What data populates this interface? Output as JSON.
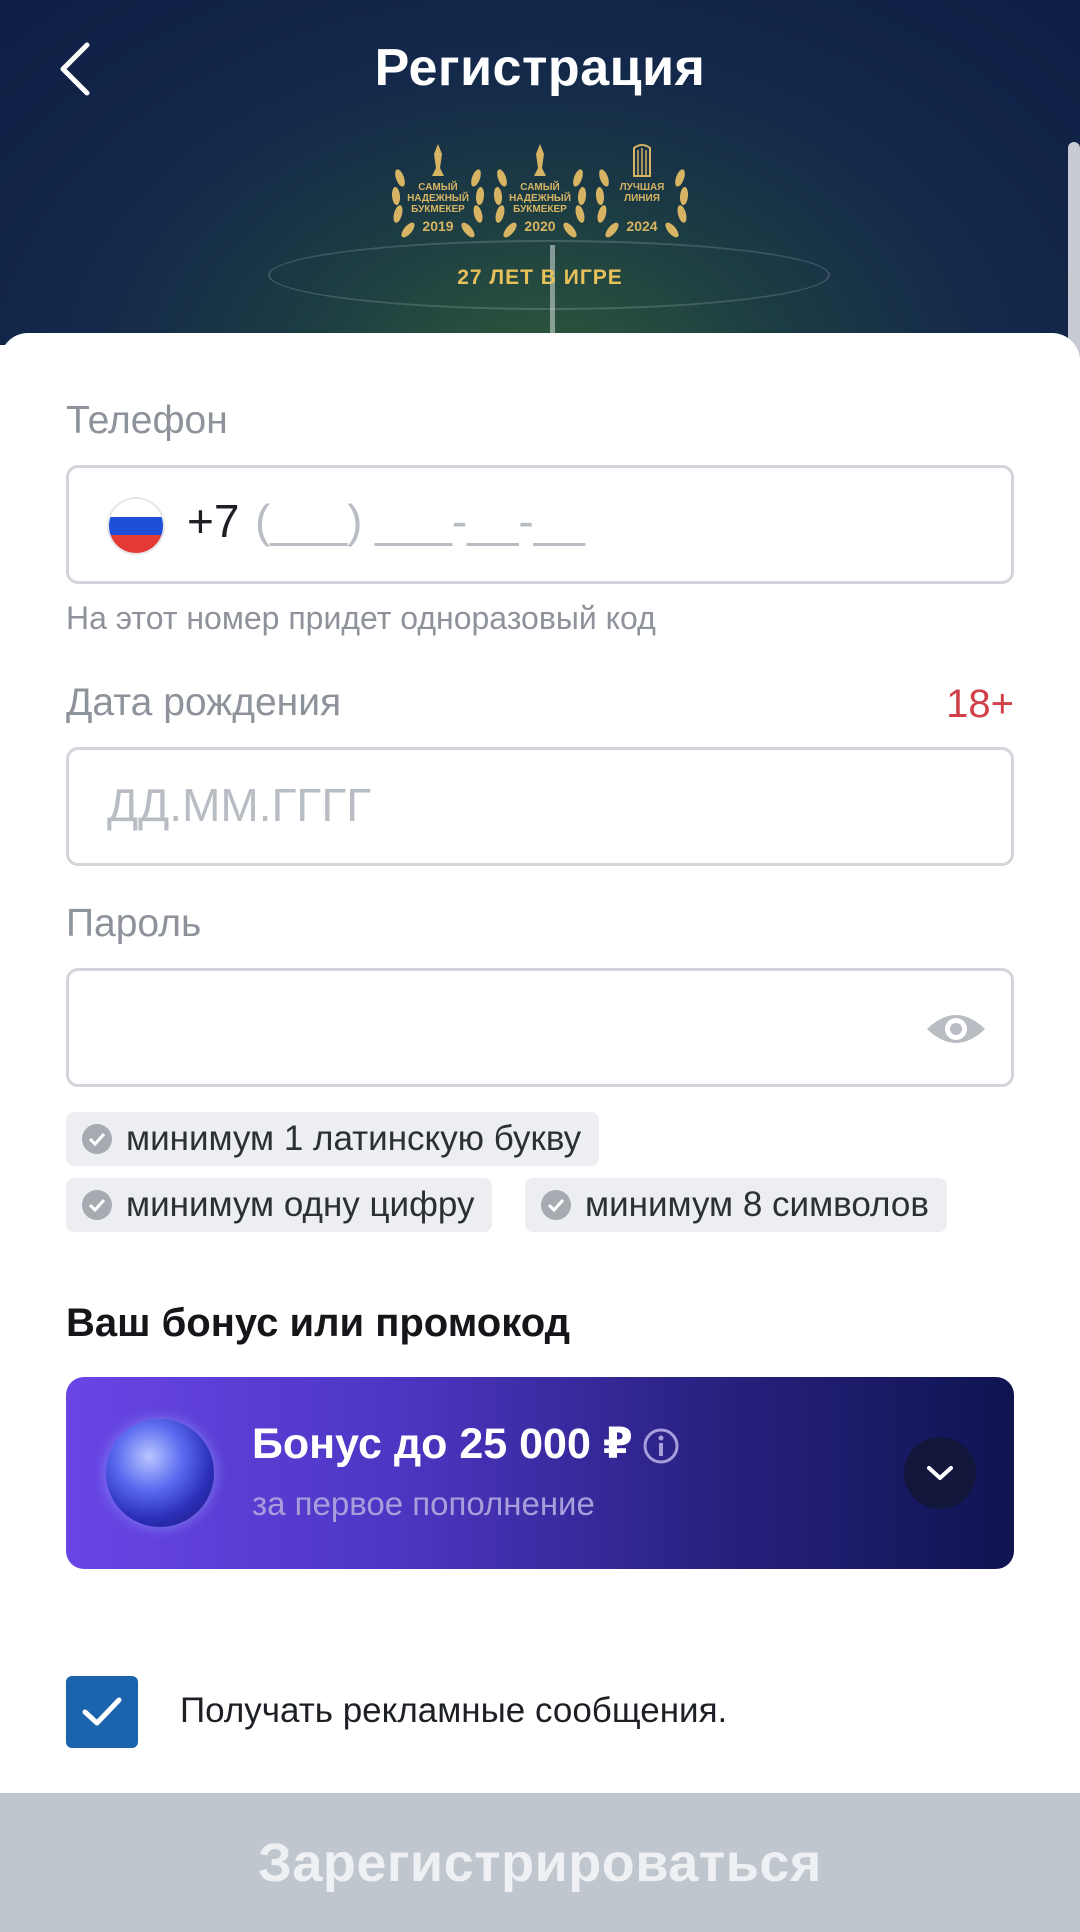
{
  "header": {
    "title": "Регистрация",
    "awards": [
      {
        "text": "САМЫЙ НАДЕЖНЫЙ БУКМЕКЕР",
        "year": "2019"
      },
      {
        "text": "САМЫЙ НАДЕЖНЫЙ БУКМЕКЕР",
        "year": "2020"
      },
      {
        "text": "ЛУЧШАЯ ЛИНИЯ",
        "year": "2024"
      }
    ],
    "badge": "27 ЛЕТ В ИГРЕ"
  },
  "form": {
    "phone": {
      "label": "Телефон",
      "country_code": "+7",
      "mask": "(___) ___-__-__",
      "hint": "На этот номер придет одноразовый код",
      "flag": "russia-flag-icon"
    },
    "birthdate": {
      "label": "Дата рождения",
      "placeholder": "ДД.ММ.ГГГГ",
      "age_limit": "18+"
    },
    "password": {
      "label": "Пароль",
      "value": "",
      "requirements": [
        "минимум 1 латинскую букву",
        "минимум одну цифру",
        "минимум 8 символов"
      ]
    },
    "bonus_section": {
      "title": "Ваш бонус или промокод",
      "bonus_title": "Бонус до 25 000 ₽",
      "bonus_subtitle": "за первое пополнение"
    },
    "promo_consent": {
      "label": "Получать рекламные сообщения.",
      "checked": true
    },
    "submit_label": "Зарегистрироваться"
  },
  "colors": {
    "header_bg": "#0e1f45",
    "gold": "#e8c15a",
    "accent_red": "#d14048",
    "checkbox_blue": "#1b63ad",
    "bonus_start": "#6a45e6",
    "bonus_end": "#0f1450",
    "submit_disabled": "#c0c6ce"
  }
}
